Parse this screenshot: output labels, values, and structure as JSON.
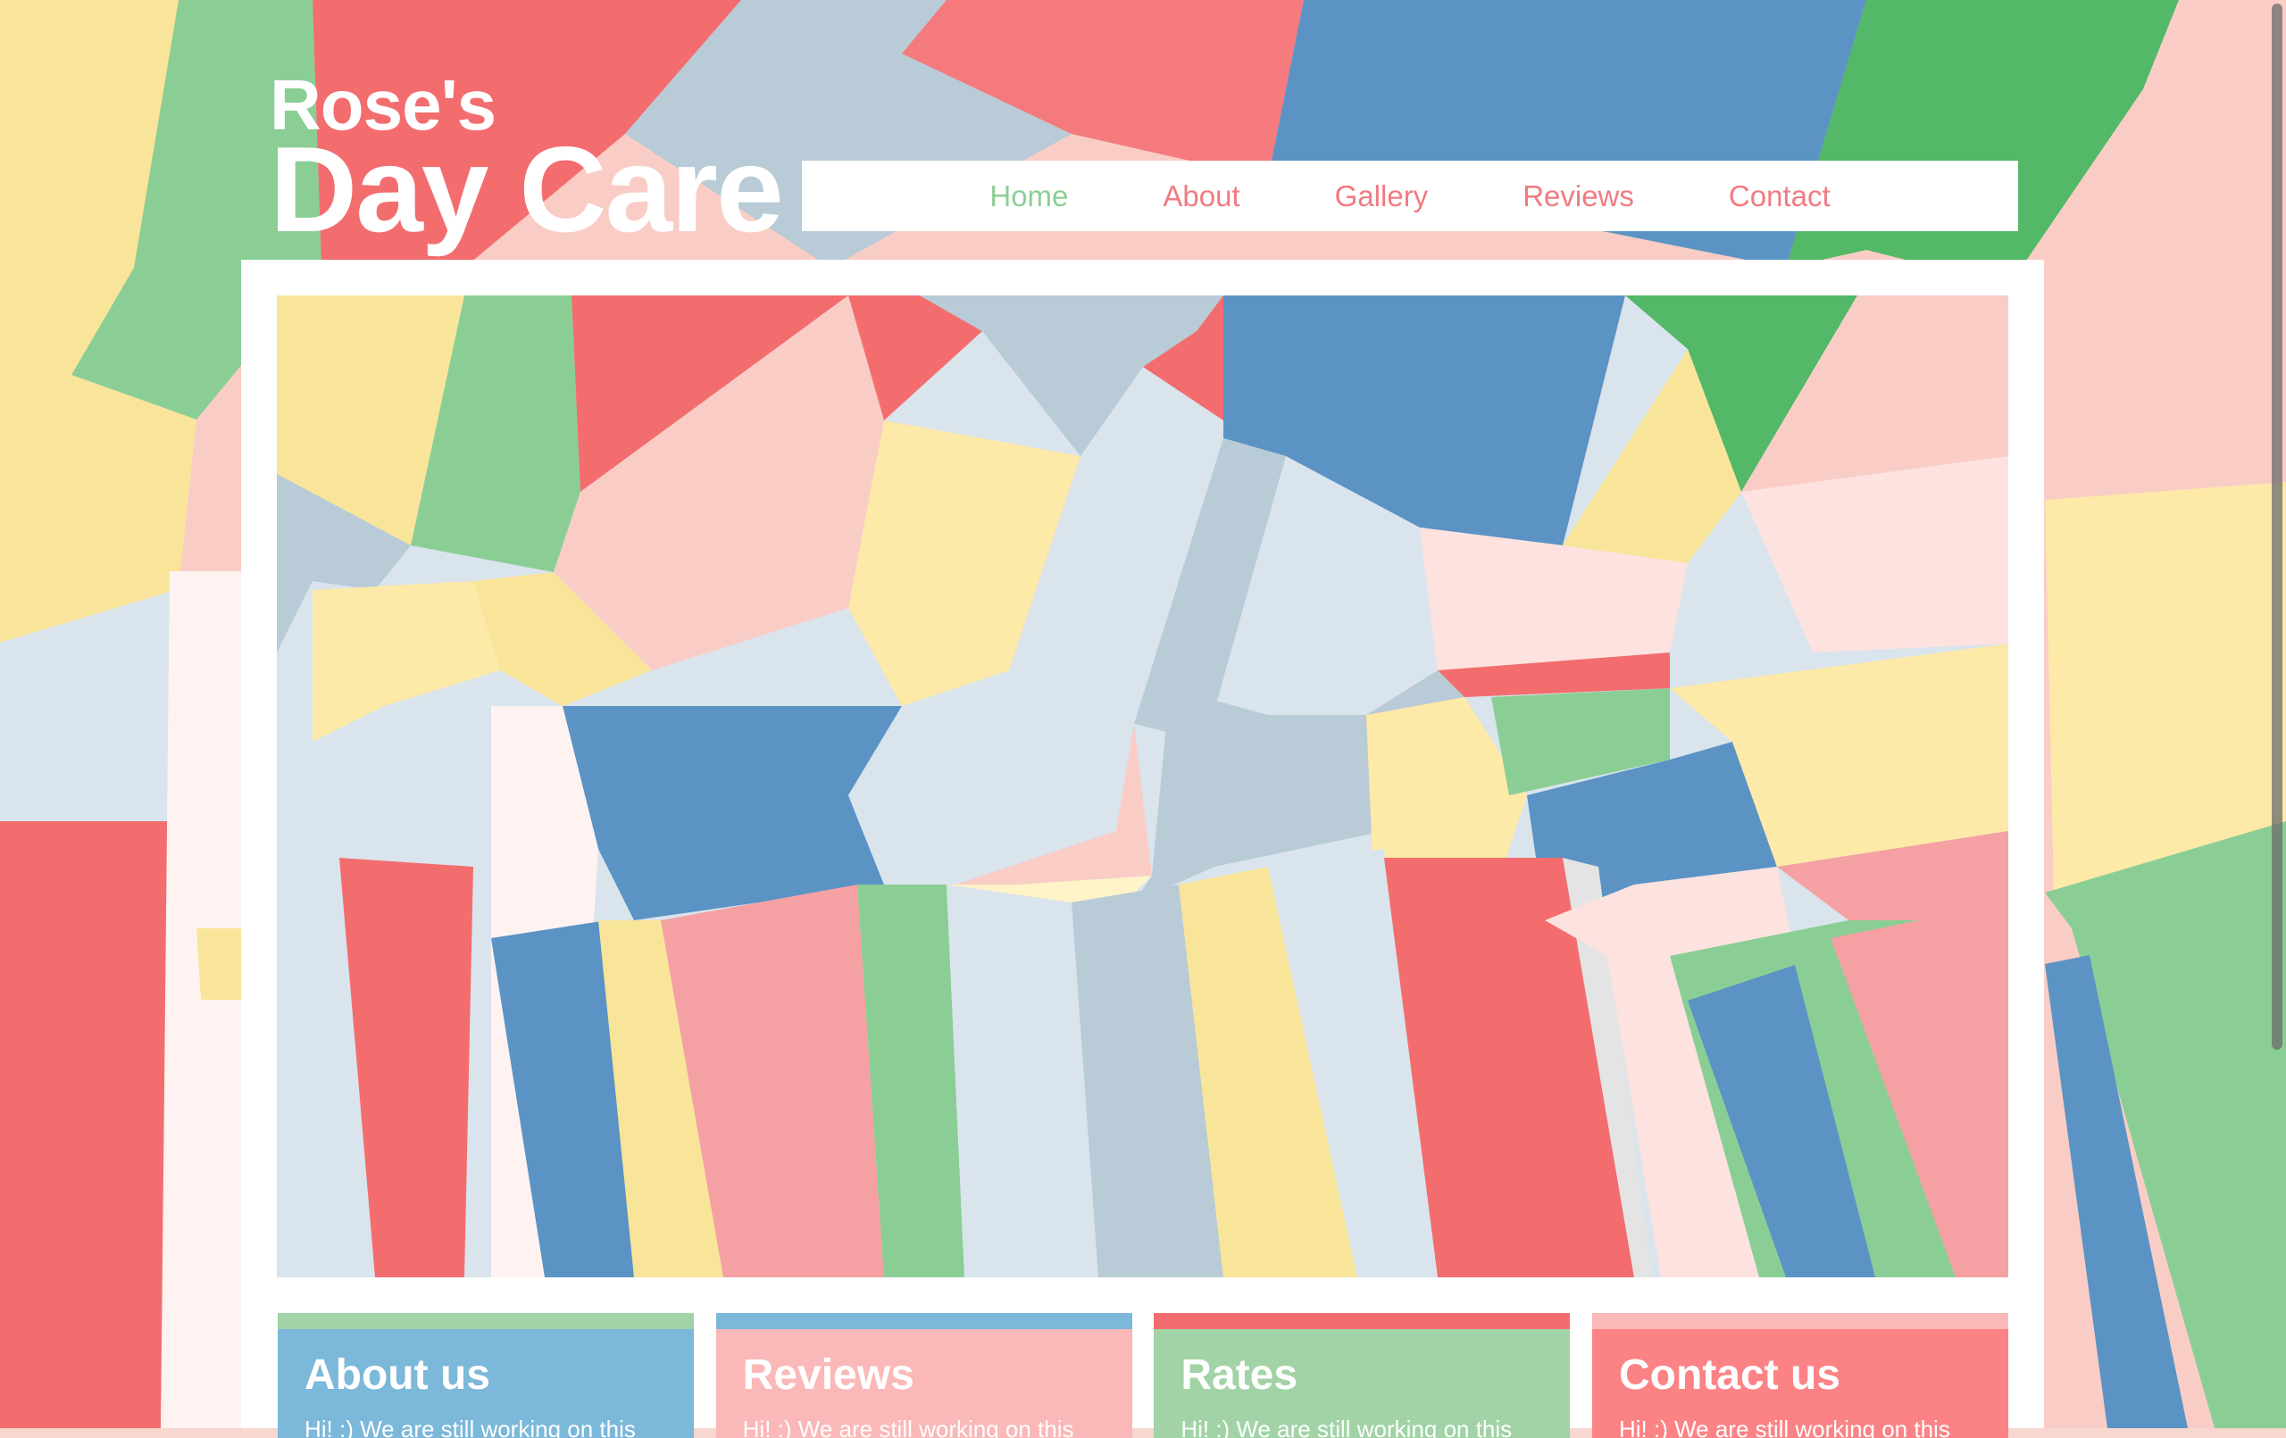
{
  "logo": {
    "line1": "Rose's",
    "line2": "Day Care"
  },
  "nav": {
    "items": [
      {
        "label": "Home",
        "active": true
      },
      {
        "label": "About",
        "active": false
      },
      {
        "label": "Gallery",
        "active": false
      },
      {
        "label": "Reviews",
        "active": false
      },
      {
        "label": "Contact",
        "active": false
      }
    ]
  },
  "cards": [
    {
      "title": "About us",
      "text": "Hi! :) We are still working on this",
      "stripe": "#a1d3a6",
      "body": "#7bb8d9"
    },
    {
      "title": "Reviews",
      "text": "Hi! :) We are still working on this",
      "stripe": "#7bb8d9",
      "body": "#fbb8b8"
    },
    {
      "title": "Rates",
      "text": "Hi! :) We are still working on this",
      "stripe": "#f36d6f",
      "body": "#a1d3a6"
    },
    {
      "title": "Contact us",
      "text": "Hi! :) We are still working on this",
      "stripe": "#fbb8b8",
      "body": "#fb8385"
    }
  ],
  "colors": {
    "nav_active": "#8ccf96",
    "nav_link": "#f07b82",
    "red": "#f36d6f",
    "pink": "#f9cdc6",
    "light_pink": "#fde2df",
    "yellow": "#f9e59a",
    "green": "#8ace95",
    "bright_green": "#53b867",
    "blue": "#5b93c5",
    "gray_blue": "#b8cbd6",
    "light_blue": "#dae4ec"
  }
}
